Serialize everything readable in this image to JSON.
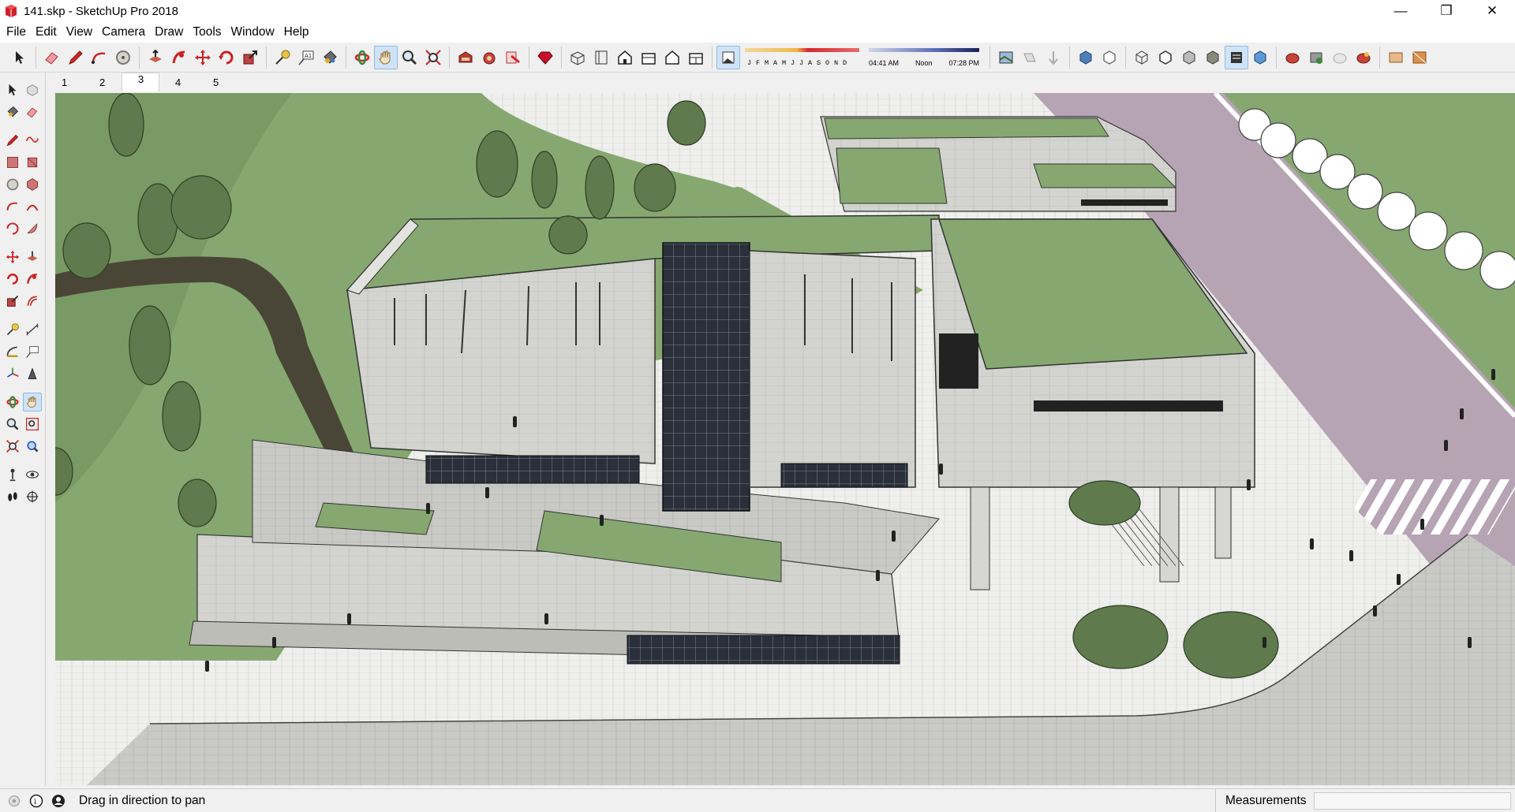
{
  "window": {
    "title": "141.skp - SketchUp Pro 2018",
    "controls": {
      "minimize": "—",
      "maximize": "❐",
      "close": "✕"
    }
  },
  "menu": [
    "File",
    "Edit",
    "View",
    "Camera",
    "Draw",
    "Tools",
    "Window",
    "Help"
  ],
  "toolbar": {
    "shadow_months": [
      "J",
      "F",
      "M",
      "A",
      "M",
      "J",
      "J",
      "A",
      "S",
      "O",
      "N",
      "D"
    ],
    "shadow_time": {
      "start": "04:41 AM",
      "mid": "Noon",
      "end": "07:28 PM"
    },
    "icons": [
      "select-icon",
      "eraser-icon",
      "pencil-icon",
      "freehand-icon",
      "circle-icon",
      "push-pull-icon",
      "follow-me-icon",
      "move-icon",
      "rotate-icon",
      "scale-icon",
      "tape-measure-icon",
      "text-icon",
      "paint-bucket-icon",
      "orbit-icon",
      "pan-icon",
      "zoom-icon",
      "zoom-extents-icon",
      "warehouse-icon",
      "extension-icon",
      "layout-icon",
      "ruby-icon",
      "iso-view-icon",
      "top-view-icon",
      "front-view-icon",
      "right-view-icon",
      "back-view-icon",
      "left-view-icon",
      "shadows-toggle-icon",
      "section-plane-icon",
      "section-display-icon",
      "section-fill-icon",
      "xray-icon",
      "back-edges-icon",
      "wireframe-icon",
      "hidden-line-icon",
      "shaded-icon",
      "shaded-textures-icon",
      "monochrome-icon",
      "sandbox-icon",
      "styles-icon",
      "match-photo-icon",
      "solid-tools-icon"
    ]
  },
  "scenes": {
    "tabs": [
      "1",
      "2",
      "3",
      "4",
      "5"
    ],
    "active": "3"
  },
  "palette": [
    "select",
    "component",
    "paint-bucket",
    "eraser",
    "line",
    "arc",
    "rectangle",
    "rotated-rectangle",
    "circle",
    "polygon",
    "two-point-arc",
    "three-point-arc",
    "pie",
    "freehand",
    "move",
    "push-pull",
    "rotate",
    "follow-me",
    "scale",
    "offset",
    "tape-measure",
    "dimension",
    "protractor",
    "text",
    "axes",
    "3d-text",
    "orbit",
    "pan",
    "zoom",
    "zoom-window",
    "zoom-extents",
    "previous",
    "position-camera",
    "look-around",
    "walk",
    "section-plane"
  ],
  "palette_active": "pan",
  "status": {
    "hint": "Drag in direction to pan",
    "measurements_label": "Measurements",
    "measurements_value": ""
  },
  "colors": {
    "grass": "#86a870",
    "road": "#b6a3b3",
    "paving": "#eeeeec",
    "concrete": "#c7c7c3",
    "roof": "#86a870",
    "glass": "#2a2f3a",
    "accent": "#cfe3f7"
  }
}
